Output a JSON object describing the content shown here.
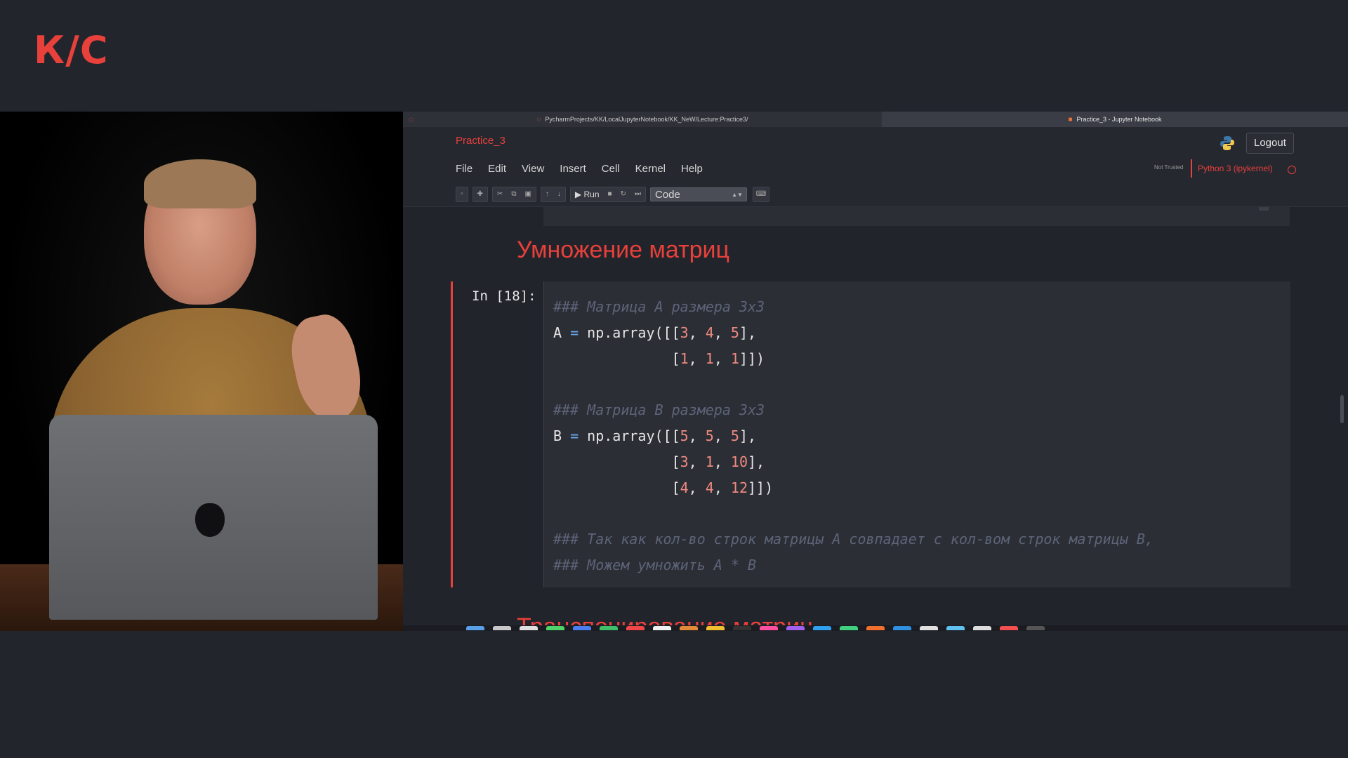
{
  "brand": {
    "logo_text": "К/С",
    "accent": "#e8403a"
  },
  "browser": {
    "tabs": [
      {
        "label": "PycharmProjects/KK/LocalJupyterNotebook/KK_NeW/Lecture:Practice3/"
      },
      {
        "label": "Practice_3 - Jupyter Notebook",
        "active": true
      }
    ]
  },
  "notebook": {
    "title": "Practice_3",
    "logout_label": "Logout",
    "menu": [
      "File",
      "Edit",
      "View",
      "Insert",
      "Cell",
      "Kernel",
      "Help"
    ],
    "trust_status": "Not Trusted",
    "kernel_name": "Python 3 (ipykernel)",
    "toolbar": {
      "save_icon": "save-icon",
      "run_label": "Run",
      "cell_type": "Code"
    },
    "heading_1": "Умножение матриц",
    "cell": {
      "prompt": "In [18]:",
      "lines": [
        "### Матрица A размера 3x3",
        "A = np.array([[3, 4, 5],",
        "              [1, 1, 1]])",
        "",
        "### Матрица B размера 3x3",
        "B = np.array([[5, 5, 5],",
        "              [3, 1, 10],",
        "              [4, 4, 12]])",
        "",
        "### Так как кол-во строк матрицы A совпадает с кол-вом строк матрицы B,",
        "### Можем умножить A * B"
      ]
    },
    "heading_2": "Транспонирование матриц"
  },
  "colors": {
    "page_bg": "#23252d",
    "comment": "#5d6478",
    "number": "#f08a7e",
    "operator": "#6aa8e8"
  }
}
